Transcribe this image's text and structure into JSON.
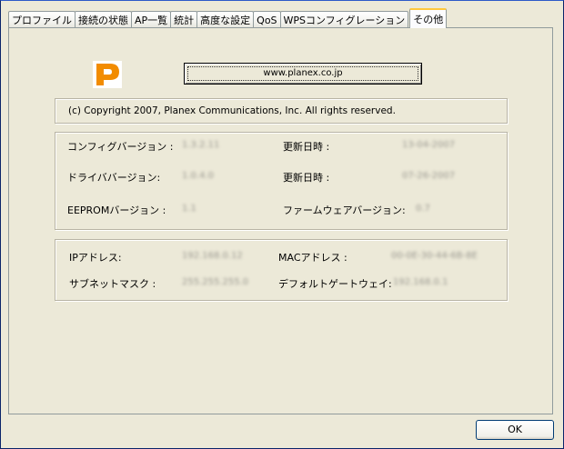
{
  "tabs": [
    {
      "label": "プロファイル"
    },
    {
      "label": "接続の状態"
    },
    {
      "label": "AP一覧"
    },
    {
      "label": "統計"
    },
    {
      "label": "高度な設定"
    },
    {
      "label": "QoS"
    },
    {
      "label": "WPSコンフィグレーション"
    },
    {
      "label": "その他"
    }
  ],
  "about": {
    "url_button": "www.planex.co.jp",
    "copyright": "(c) Copyright 2007, Planex Communications, Inc. All rights reserved."
  },
  "version_info": {
    "config_version_label": "コンフィグバージョン :",
    "config_version_value": "1.3.2.11",
    "config_date_label": "更新日時 :",
    "config_date_value": "13-04-2007",
    "driver_version_label": "ドライババージョン:",
    "driver_version_value": "1.0.4.0",
    "driver_date_label": "更新日時 :",
    "driver_date_value": "07-26-2007",
    "eeprom_version_label": "EEPROMバージョン :",
    "eeprom_version_value": "1.1",
    "firmware_version_label": "ファームウェアバージョン:",
    "firmware_version_value": "0.7"
  },
  "network_info": {
    "ip_label": "IPアドレス:",
    "ip_value": "192.168.0.12",
    "mac_label": "MACアドレス :",
    "mac_value": "00-0E-30-44-6B-8E",
    "subnet_label": "サブネットマスク :",
    "subnet_value": "255.255.255.0",
    "gateway_label": "デフォルトゲートウェイ:",
    "gateway_value": "192.168.0.1"
  },
  "footer": {
    "ok_label": "OK"
  },
  "colors": {
    "logo": "#F28C00",
    "active_tab_accent": "#FFC83C",
    "dialog_bg": "#ECE9D8"
  }
}
